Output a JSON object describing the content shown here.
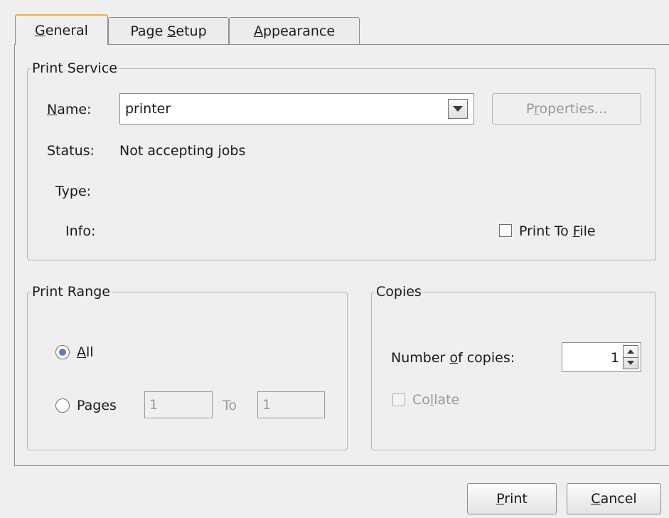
{
  "tabs": [
    {
      "pre": "",
      "mn": "G",
      "post": "eneral",
      "active": true
    },
    {
      "pre": "Page ",
      "mn": "S",
      "post": "etup",
      "active": false
    },
    {
      "pre": "",
      "mn": "A",
      "post": "ppearance",
      "active": false
    }
  ],
  "print_service": {
    "title": "Print Service",
    "name_label": {
      "pre": "",
      "mn": "N",
      "post": "ame:"
    },
    "printer_value": "printer",
    "properties_button": {
      "pre": "P",
      "mn": "r",
      "post": "operties..."
    },
    "status_label": "Status:",
    "status_value": "Not accepting jobs",
    "type_label": "Type:",
    "info_label": "Info:",
    "print_to_file": {
      "pre": "Print To ",
      "mn": "F",
      "post": "ile",
      "checked": false
    }
  },
  "print_range": {
    "title": "Print Range",
    "all": {
      "pre": "",
      "mn": "A",
      "post": "ll",
      "selected": true
    },
    "pages": {
      "pre": "Pa",
      "mn": "g",
      "post": "es",
      "selected": false
    },
    "from_value": "1",
    "to_label": "To",
    "to_value": "1"
  },
  "copies": {
    "title": "Copies",
    "number_label": {
      "pre": "Number ",
      "mn": "o",
      "post": "f copies:"
    },
    "number_value": "1",
    "collate": {
      "pre": "Co",
      "mn": "l",
      "post": "late",
      "checked": false
    }
  },
  "footer": {
    "print_button": {
      "pre": "",
      "mn": "P",
      "post": "rint"
    },
    "cancel_button": {
      "pre": "",
      "mn": "C",
      "post": "ancel"
    }
  },
  "colors": {
    "background": "#efefef",
    "active_tab_accent": "#e3b24a",
    "radio_selected": "#5b7fc2",
    "disabled_text": "#9a9a9a"
  }
}
